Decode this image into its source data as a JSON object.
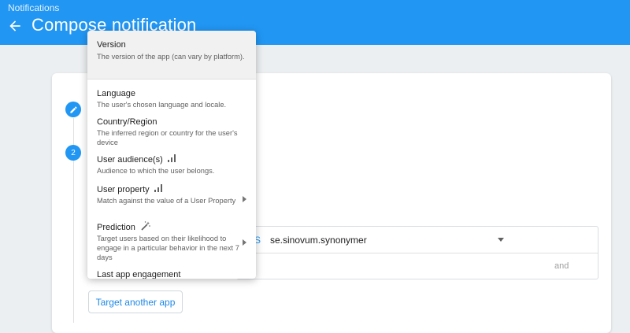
{
  "header": {
    "breadcrumb": "Notifications",
    "title": "Compose notification"
  },
  "steps": {
    "step2_number": "2"
  },
  "form": {
    "app_prefix": "S",
    "selected_app": "se.sinovum.synonymer",
    "and_label": "and",
    "target_another_app": "Target another app"
  },
  "menu": {
    "items": [
      {
        "label": "Version",
        "desc": "The version of the app (can vary by platform)."
      },
      {
        "label": "Language",
        "desc": "The user's chosen language and locale."
      },
      {
        "label": "Country/Region",
        "desc": "The inferred region or country for the user's device"
      },
      {
        "label": "User audience(s)",
        "desc": "Audience to which the user belongs.",
        "icon": "bar-chart-icon"
      },
      {
        "label": "User property",
        "desc": "Match against the value of a User Property",
        "icon": "bar-chart-icon",
        "submenu": true
      },
      {
        "label": "Prediction",
        "desc": "Target users based on their likelihood to engage in a particular behavior in the next 7 days",
        "icon": "magic-wand-icon",
        "submenu": true
      },
      {
        "label": "Last app engagement"
      }
    ]
  },
  "colors": {
    "primary": "#2196f3",
    "accent_text": "#1e88e5"
  }
}
